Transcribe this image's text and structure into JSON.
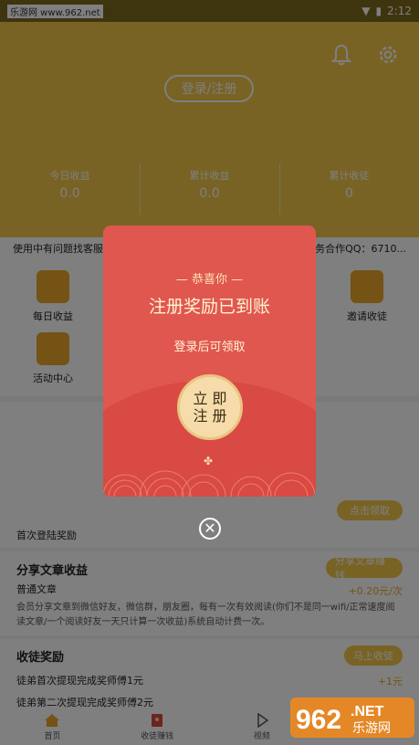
{
  "status": {
    "watermark": "乐游网 www.962.net",
    "time": "2:12"
  },
  "header": {
    "login_label": "登录/注册"
  },
  "stats": [
    {
      "label": "今日收益",
      "value": "0.0"
    },
    {
      "label": "累计收益",
      "value": "0.0"
    },
    {
      "label": "累计收徒",
      "value": "0"
    }
  ],
  "notice": {
    "left": "使用中有问题找客服",
    "right": "商务合作QQ：6710..."
  },
  "grid": {
    "daily": "每日收益",
    "activity": "活动中心",
    "invite": "邀请收徒"
  },
  "sections": {
    "check_btn": "点击领取",
    "first_login": "首次登陆奖励",
    "share_title": "分享文章收益",
    "share_btn": "分享文章赚钱",
    "normal_article": "普通文章",
    "normal_reward": "+0.20元/次",
    "share_desc": "会员分享文章到微信好友，微信群，朋友圈，每有一次有效阅读(你们不是同一wifi/正常速度阅读文章/一个阅读好友一天只计算一次收益)系统自动计费一次。",
    "apprentice_title": "收徒奖励",
    "apprentice_btn": "马上收徒",
    "apprentice_1": "徒弟首次提现完成奖师傅1元",
    "apprentice_1_reward": "+1元",
    "apprentice_2": "徒弟第二次提现完成奖师傅2元"
  },
  "tabs": [
    "首页",
    "收徒赚钱",
    "视频"
  ],
  "modal": {
    "small_title": "— 恭喜你 —",
    "big_title": "注册奖励已到账",
    "subtitle": "登录后可领取",
    "button_line1": "立 即",
    "button_line2": "注 册",
    "close": "✕"
  },
  "watermark_logo": {
    "text1": "962",
    "text2": ".NET",
    "text3": "乐游网"
  },
  "colors": {
    "accent": "#f0c64a",
    "red": "#e0574f",
    "gold": "#f6dcaa"
  }
}
